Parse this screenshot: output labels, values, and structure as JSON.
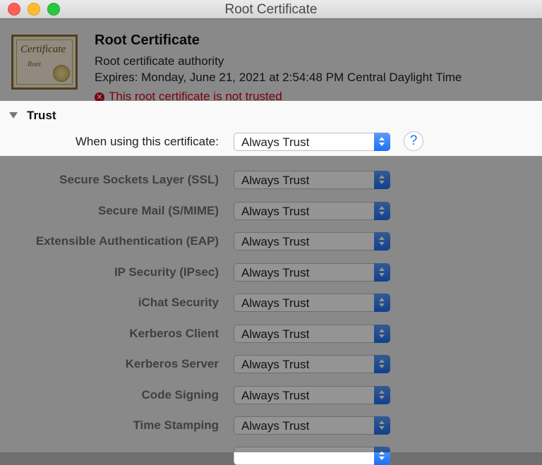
{
  "window": {
    "title": "Root Certificate"
  },
  "certificate": {
    "name": "Root Certificate",
    "subtitle": "Root certificate authority",
    "expires": "Expires: Monday, June 21, 2021 at 2:54:48 PM Central Daylight Time",
    "warning": "This root certificate is not trusted",
    "icon_word": "Certificate",
    "icon_sub": "Root"
  },
  "trust": {
    "heading": "Trust",
    "main_label": "When using this certificate:",
    "main_value": "Always Trust",
    "help": "?"
  },
  "policies": [
    {
      "label": "Secure Sockets Layer (SSL)",
      "value": "Always Trust"
    },
    {
      "label": "Secure Mail (S/MIME)",
      "value": "Always Trust"
    },
    {
      "label": "Extensible Authentication (EAP)",
      "value": "Always Trust"
    },
    {
      "label": "IP Security (IPsec)",
      "value": "Always Trust"
    },
    {
      "label": "iChat Security",
      "value": "Always Trust"
    },
    {
      "label": "Kerberos Client",
      "value": "Always Trust"
    },
    {
      "label": "Kerberos Server",
      "value": "Always Trust"
    },
    {
      "label": "Code Signing",
      "value": "Always Trust"
    },
    {
      "label": "Time Stamping",
      "value": "Always Trust"
    }
  ],
  "colors": {
    "accent": "#1d6ff3",
    "warning": "#d0021b"
  }
}
